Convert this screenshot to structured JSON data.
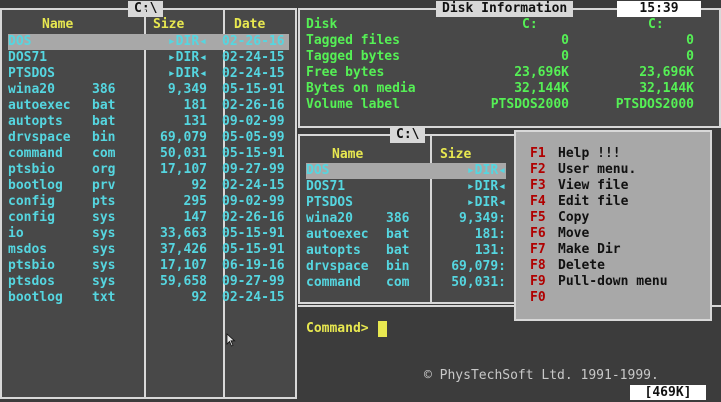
{
  "left_panel": {
    "path": "C:\\",
    "headers": {
      "name": "Name",
      "size": "Size",
      "date": "Date"
    },
    "files": [
      {
        "name": "DOS",
        "ext": "",
        "size": "▸DIR◂",
        "date": "02-26-16",
        "selected": true
      },
      {
        "name": "DOS71",
        "ext": "",
        "size": "▸DIR◂",
        "date": "02-24-15"
      },
      {
        "name": "PTSDOS",
        "ext": "",
        "size": "▸DIR◂",
        "date": "02-24-15"
      },
      {
        "name": "wina20",
        "ext": "386",
        "size": "9,349",
        "date": "05-15-91"
      },
      {
        "name": "autoexec",
        "ext": "bat",
        "size": "181",
        "date": "02-26-16"
      },
      {
        "name": "autopts",
        "ext": "bat",
        "size": "131",
        "date": "09-02-99"
      },
      {
        "name": "drvspace",
        "ext": "bin",
        "size": "69,079",
        "date": "05-05-99"
      },
      {
        "name": "command",
        "ext": "com",
        "size": "50,031",
        "date": "05-15-91"
      },
      {
        "name": "ptsbio",
        "ext": "org",
        "size": "17,107",
        "date": "09-27-99"
      },
      {
        "name": "bootlog",
        "ext": "prv",
        "size": "92",
        "date": "02-24-15"
      },
      {
        "name": "config",
        "ext": "pts",
        "size": "295",
        "date": "09-02-99"
      },
      {
        "name": "config",
        "ext": "sys",
        "size": "147",
        "date": "02-26-16"
      },
      {
        "name": "io",
        "ext": "sys",
        "size": "33,663",
        "date": "05-15-91"
      },
      {
        "name": "msdos",
        "ext": "sys",
        "size": "37,426",
        "date": "05-15-91"
      },
      {
        "name": "ptsbio",
        "ext": "sys",
        "size": "17,107",
        "date": "06-19-16"
      },
      {
        "name": "ptsdos",
        "ext": "sys",
        "size": "59,658",
        "date": "09-27-99"
      },
      {
        "name": "bootlog",
        "ext": "txt",
        "size": "92",
        "date": "02-24-15"
      }
    ]
  },
  "disk_info": {
    "title": "Disk Information",
    "clock": "15:39",
    "header_label": "Disk",
    "drive_a": "C:",
    "drive_b": "C:",
    "rows": [
      {
        "label": "Tagged files",
        "a": "0",
        "b": "0"
      },
      {
        "label": "Tagged bytes",
        "a": "0",
        "b": "0"
      },
      {
        "label": "Free bytes",
        "a": "23,696K",
        "b": "23,696K"
      },
      {
        "label": "Bytes on media",
        "a": "32,144K",
        "b": "32,144K"
      },
      {
        "label": "Volume label",
        "a": "PTSDOS2000",
        "b": "PTSDOS2000"
      }
    ]
  },
  "right_panel": {
    "path": "C:\\",
    "headers": {
      "name": "Name",
      "size": "Size"
    },
    "files": [
      {
        "name": "DOS",
        "ext": "",
        "size": "▸DIR◂",
        "selected": true
      },
      {
        "name": "DOS71",
        "ext": "",
        "size": "▸DIR◂"
      },
      {
        "name": "PTSDOS",
        "ext": "",
        "size": "▸DIR◂"
      },
      {
        "name": "wina20",
        "ext": "386",
        "size": "9,349:"
      },
      {
        "name": "autoexec",
        "ext": "bat",
        "size": "181:"
      },
      {
        "name": "autopts",
        "ext": "bat",
        "size": "131:"
      },
      {
        "name": "drvspace",
        "ext": "bin",
        "size": "69,079:"
      },
      {
        "name": "command",
        "ext": "com",
        "size": "50,031:"
      }
    ]
  },
  "fkey_menu": [
    {
      "key": "F1",
      "label": "Help !!!"
    },
    {
      "key": "F2",
      "label": "User menu."
    },
    {
      "key": "F3",
      "label": "View file"
    },
    {
      "key": "F4",
      "label": "Edit file"
    },
    {
      "key": "F5",
      "label": "Copy"
    },
    {
      "key": "F6",
      "label": "Move"
    },
    {
      "key": "F7",
      "label": "Make Dir"
    },
    {
      "key": "F8",
      "label": "Delete"
    },
    {
      "key": "F9",
      "label": "Pull-down menu"
    },
    {
      "key": "F0",
      "label": ""
    }
  ],
  "command_line": {
    "prompt": "Command>"
  },
  "copyright": "© PhysTechSoft Ltd. 1991-1999.",
  "memory": "[469K]",
  "colors": {
    "background": "#3c3c3c",
    "panel": "#484848",
    "filename": "#e8e850",
    "info": "#55f055",
    "selection": "#a8a8a8",
    "fkey": "#b00000"
  }
}
